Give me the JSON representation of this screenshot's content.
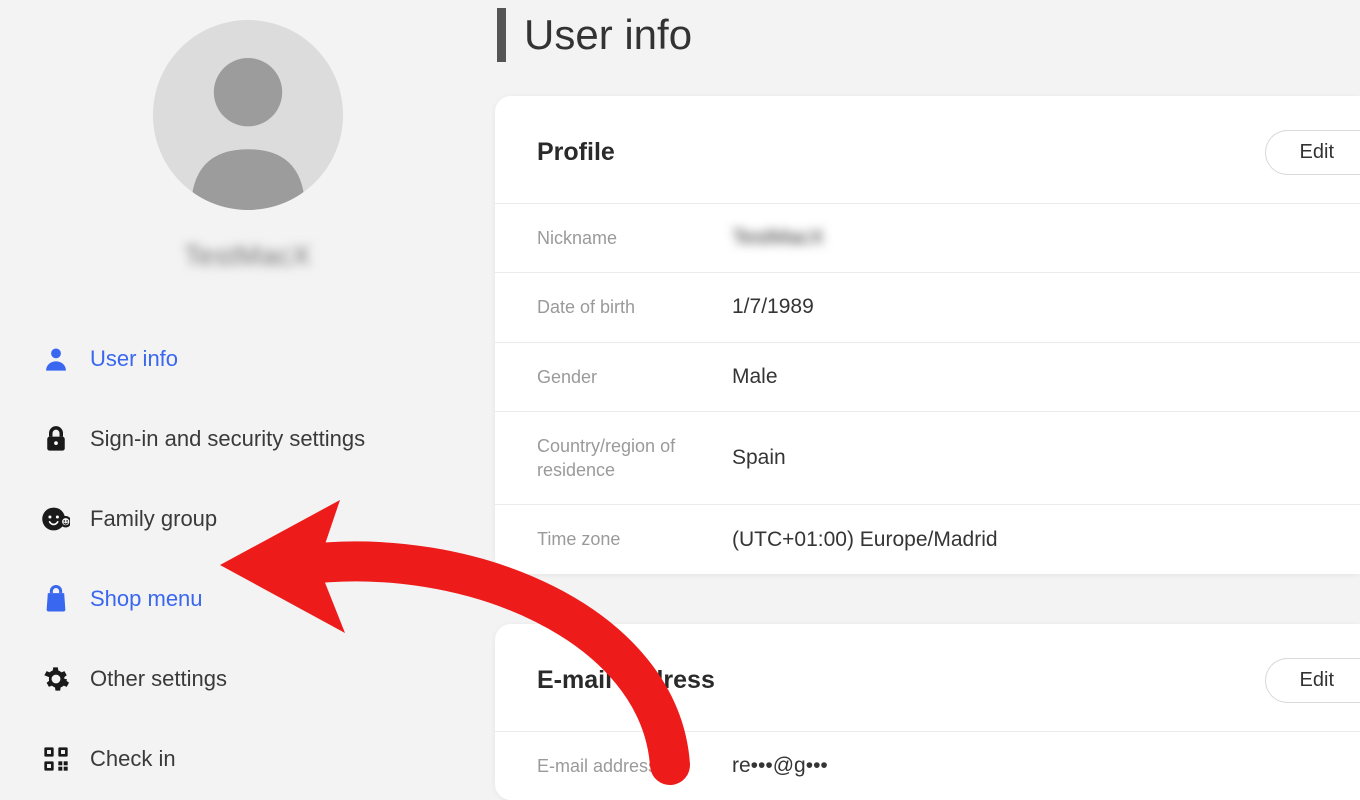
{
  "sidebar": {
    "username": "TestMacX",
    "items": [
      {
        "label": "User info"
      },
      {
        "label": "Sign-in and security settings"
      },
      {
        "label": "Family group"
      },
      {
        "label": "Shop menu"
      },
      {
        "label": "Other settings"
      },
      {
        "label": "Check in"
      }
    ]
  },
  "page": {
    "title": "User info"
  },
  "profile": {
    "heading": "Profile",
    "edit": "Edit",
    "rows": {
      "nickname_label": "Nickname",
      "nickname_value": "TestMacX",
      "dob_label": "Date of birth",
      "dob_value": "1/7/1989",
      "gender_label": "Gender",
      "gender_value": "Male",
      "country_label": "Country/region of residence",
      "country_value": "Spain",
      "tz_label": "Time zone",
      "tz_value": "(UTC+01:00) Europe/Madrid"
    }
  },
  "email": {
    "heading": "E-mail address",
    "edit": "Edit",
    "rows": {
      "email_label": "E-mail address",
      "email_value": "re•••@g•••"
    }
  }
}
